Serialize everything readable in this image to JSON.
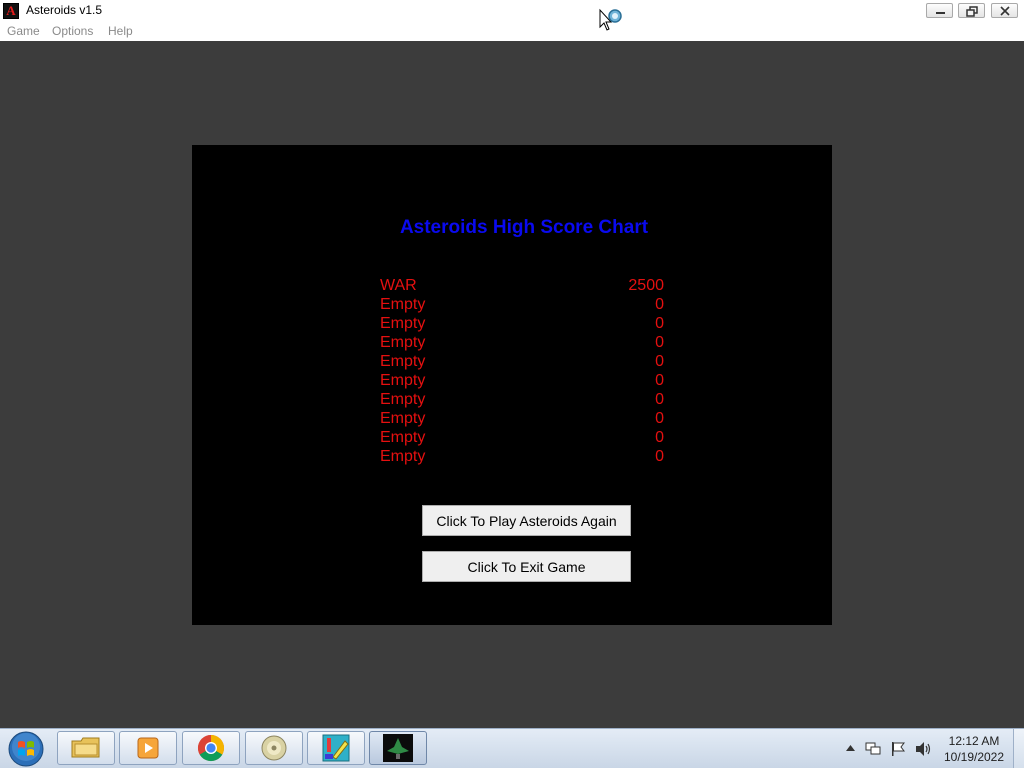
{
  "window": {
    "title": "Asteroids v1.5",
    "icon_letter": "A"
  },
  "menu": {
    "items": [
      "Game",
      "Options",
      "Help"
    ]
  },
  "high_scores": {
    "title": "Asteroids High Score Chart",
    "entries": [
      {
        "name": "WAR",
        "score": "2500"
      },
      {
        "name": "Empty",
        "score": "0"
      },
      {
        "name": "Empty",
        "score": "0"
      },
      {
        "name": "Empty",
        "score": "0"
      },
      {
        "name": "Empty",
        "score": "0"
      },
      {
        "name": "Empty",
        "score": "0"
      },
      {
        "name": "Empty",
        "score": "0"
      },
      {
        "name": "Empty",
        "score": "0"
      },
      {
        "name": "Empty",
        "score": "0"
      },
      {
        "name": "Empty",
        "score": "0"
      }
    ]
  },
  "buttons": {
    "play_again": "Click To Play Asteroids Again",
    "exit_game": "Click To Exit Game"
  },
  "taskbar": {
    "items": [
      "file-explorer-icon",
      "media-player-icon",
      "chrome-icon",
      "dvd-icon",
      "paint-app-icon",
      "asteroids-app-icon"
    ],
    "clock_time": "12:12 AM",
    "clock_date": "10/19/2022"
  },
  "colors": {
    "title_blue": "#0a0af0",
    "score_red": "#e51010",
    "panel_black": "#000000",
    "background": "#3c3c3c"
  }
}
